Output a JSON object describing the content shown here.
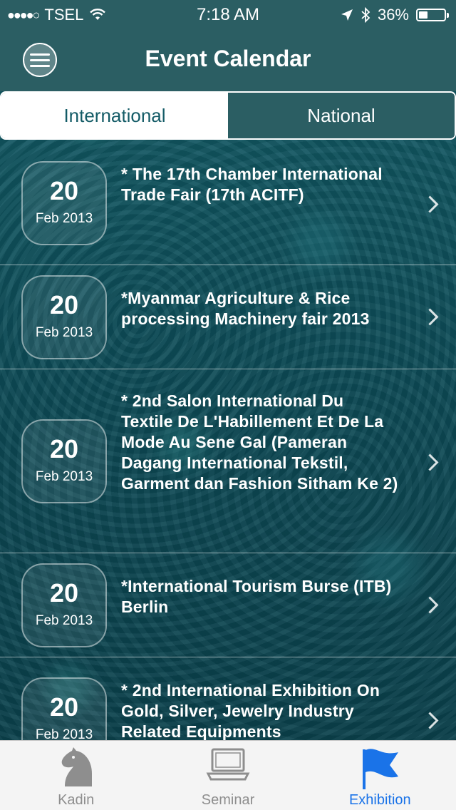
{
  "status_bar": {
    "signal": "●●●●○",
    "carrier": "TSEL",
    "time": "7:18 AM",
    "battery": "36%"
  },
  "header": {
    "title": "Event Calendar"
  },
  "segments": [
    {
      "label": "International",
      "active": true
    },
    {
      "label": "National",
      "active": false
    }
  ],
  "events": [
    {
      "day": "20",
      "month": "Feb 2013",
      "title": "* The 17th Chamber International Trade Fair (17th ACITF)"
    },
    {
      "day": "20",
      "month": "Feb 2013",
      "title": "*Myanmar Agriculture & Rice processing Machinery fair 2013"
    },
    {
      "day": "20",
      "month": "Feb 2013",
      "title": "* 2nd Salon International Du Textile De L'Habillement Et De La Mode Au Sene Gal (Pameran Dagang International Tekstil, Garment dan Fashion Sitham Ke 2)"
    },
    {
      "day": "20",
      "month": "Feb 2013",
      "title": "*International Tourism Burse (ITB) Berlin"
    },
    {
      "day": "20",
      "month": "Feb 2013",
      "title": "* 2nd International Exhibition On Gold, Silver, Jewelry Industry Related Equipments"
    }
  ],
  "tabs": [
    {
      "label": "Kadin",
      "icon": "horse-icon",
      "active": false
    },
    {
      "label": "Seminar",
      "icon": "laptop-icon",
      "active": false
    },
    {
      "label": "Exhibition",
      "icon": "flag-icon",
      "active": true
    }
  ],
  "colors": {
    "header_bg": "#2b5e63",
    "active_tab": "#1a73e8"
  }
}
